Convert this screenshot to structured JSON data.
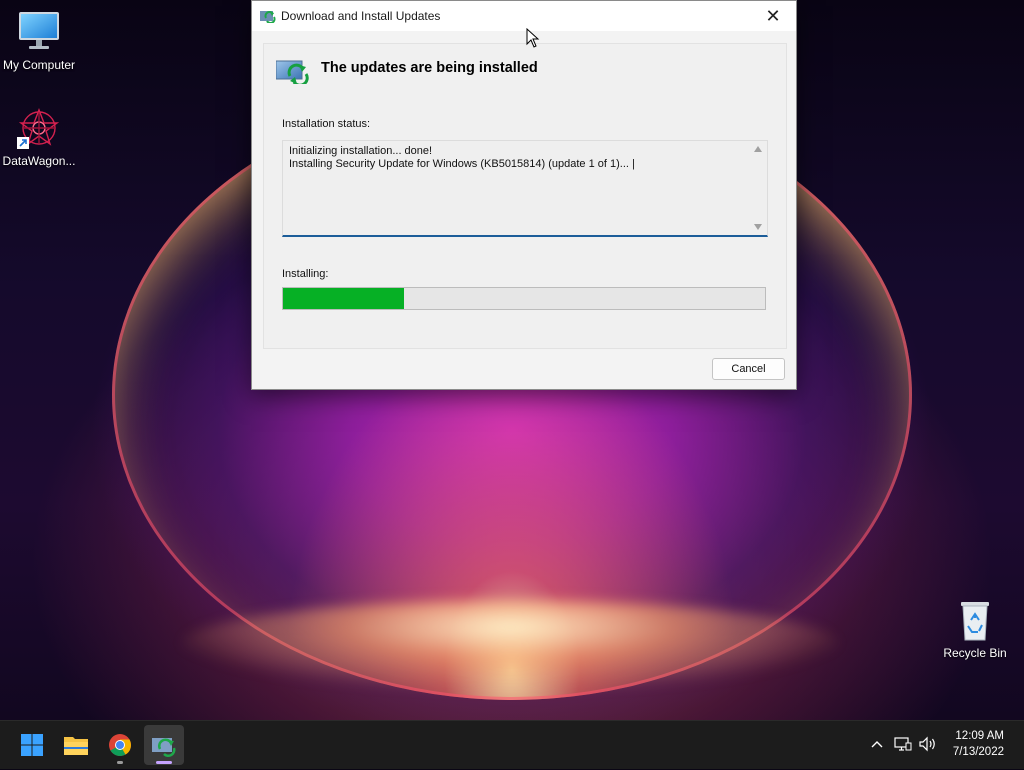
{
  "desktop": {
    "icons": [
      {
        "label": "My Computer",
        "icon": "computer-monitor-icon"
      },
      {
        "label": "DataWagon...",
        "icon": "datawagon-app-icon"
      },
      {
        "label": "Recycle Bin",
        "icon": "recycle-bin-icon"
      }
    ]
  },
  "dialog": {
    "title": "Download and Install Updates",
    "close_label": "✕",
    "header": "The updates are being installed",
    "status_label": "Installation status:",
    "status_lines": "Initializing installation... done!\nInstalling Security Update for Windows (KB5015814) (update 1 of 1)... |",
    "installing_label": "Installing:",
    "progress": 0.25,
    "progress_color": "#06b025",
    "cancel_label": "Cancel"
  },
  "taskbar": {
    "items": [
      {
        "name": "start",
        "icon": "windows-start-icon"
      },
      {
        "name": "file-explorer",
        "icon": "folder-icon"
      },
      {
        "name": "chrome",
        "icon": "chrome-icon",
        "running": true
      },
      {
        "name": "windows-update",
        "icon": "update-icon",
        "running": true,
        "active": true
      }
    ],
    "tray_icons": [
      "chevron-up-icon",
      "network-icon",
      "volume-icon"
    ],
    "time": "12:09 AM",
    "date": "7/13/2022"
  }
}
